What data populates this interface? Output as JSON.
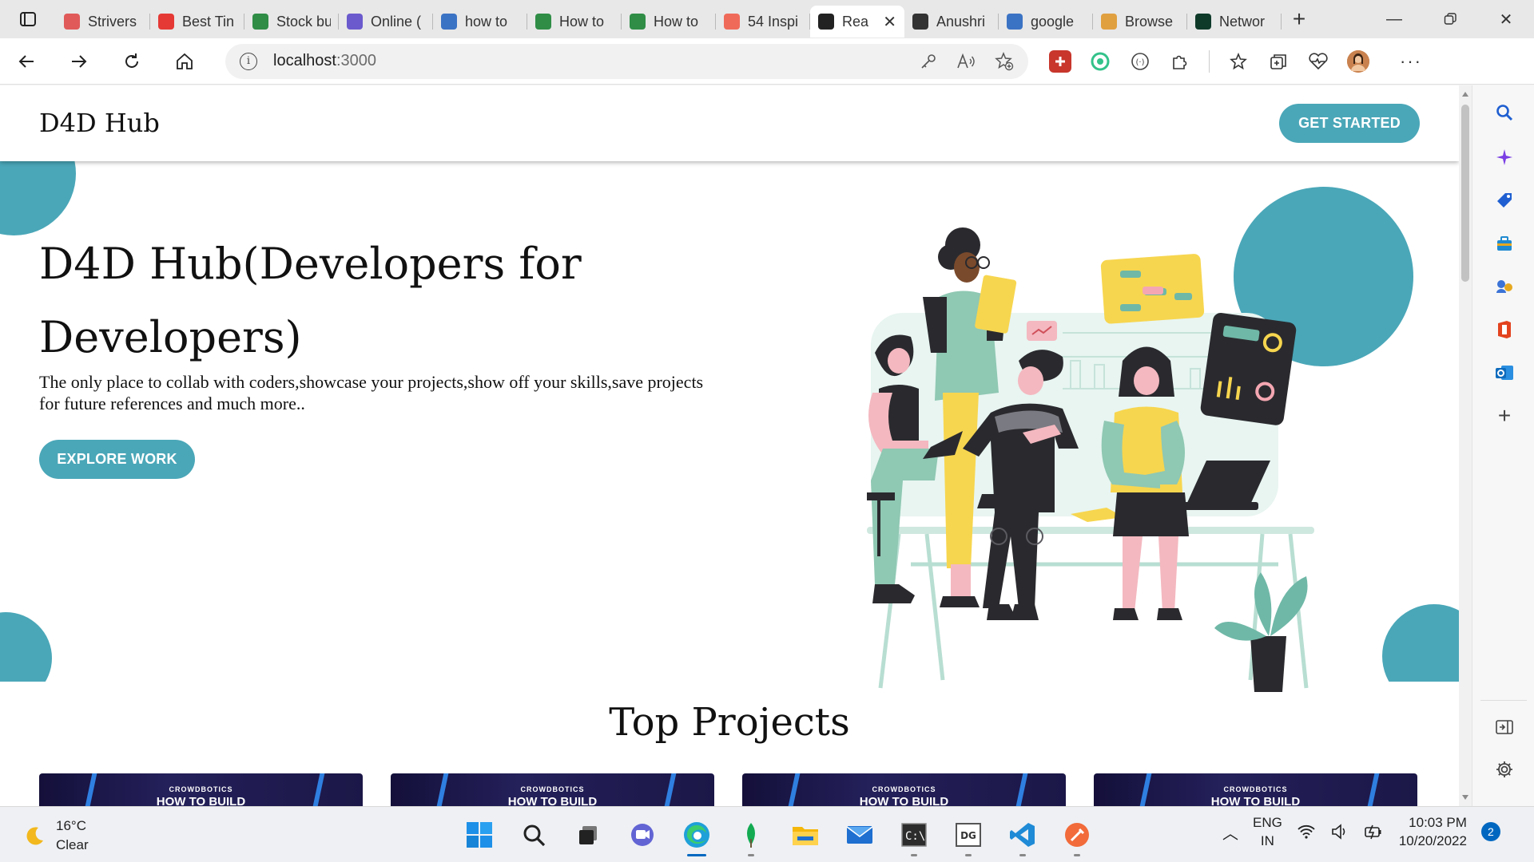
{
  "browser": {
    "tabs": [
      {
        "label": "Strivers",
        "favicon": "tuf-icon",
        "color": "#e05a5a"
      },
      {
        "label": "Best Tin",
        "favicon": "youtube-icon",
        "color": "#e53935"
      },
      {
        "label": "Stock bu",
        "favicon": "gfg-icon",
        "color": "#2f8d46"
      },
      {
        "label": "Online (",
        "favicon": "bolt-icon",
        "color": "#6a5acd"
      },
      {
        "label": "how to",
        "favicon": "search-icon",
        "color": "#3b73c4"
      },
      {
        "label": "How to",
        "favicon": "gfg-icon",
        "color": "#2f8d46"
      },
      {
        "label": "How to",
        "favicon": "gfg-icon",
        "color": "#2f8d46"
      },
      {
        "label": "54 Inspi",
        "favicon": "99d-icon",
        "color": "#f06a5a"
      },
      {
        "label": "Rea",
        "favicon": "react-icon",
        "color": "#222222",
        "active": true
      },
      {
        "label": "Anushri",
        "favicon": "github-icon",
        "color": "#333333"
      },
      {
        "label": "google",
        "favicon": "search-icon",
        "color": "#3b73c4"
      },
      {
        "label": "Browse",
        "favicon": "color-icon",
        "color": "#e0a040"
      },
      {
        "label": "Networ",
        "favicon": "mongodb-icon",
        "color": "#0f3a2a"
      }
    ],
    "url_host": "localhost",
    "url_port": ":3000"
  },
  "site": {
    "brand": "D4D Hub",
    "cta": "GET STARTED",
    "hero_title": "D4D Hub(Developers for Developers)",
    "hero_subtitle": "The only place to collab with coders,showcase your projects,show off your skills,save projects for future references and much more..",
    "explore": "EXPLORE WORK",
    "section_title": "Top Projects",
    "cards": [
      {
        "line1": "CROWDBOTICS",
        "line2": "HOW TO BUILD"
      },
      {
        "line1": "CROWDBOTICS",
        "line2": "HOW TO BUILD"
      },
      {
        "line1": "CROWDBOTICS",
        "line2": "HOW TO BUILD"
      },
      {
        "line1": "CROWDBOTICS",
        "line2": "HOW TO BUILD"
      }
    ],
    "accent": "#4aa7b8"
  },
  "taskbar": {
    "temp": "16°C",
    "condition": "Clear",
    "lang1": "ENG",
    "lang2": "IN",
    "time": "10:03 PM",
    "date": "10/20/2022",
    "notifications": "2"
  }
}
